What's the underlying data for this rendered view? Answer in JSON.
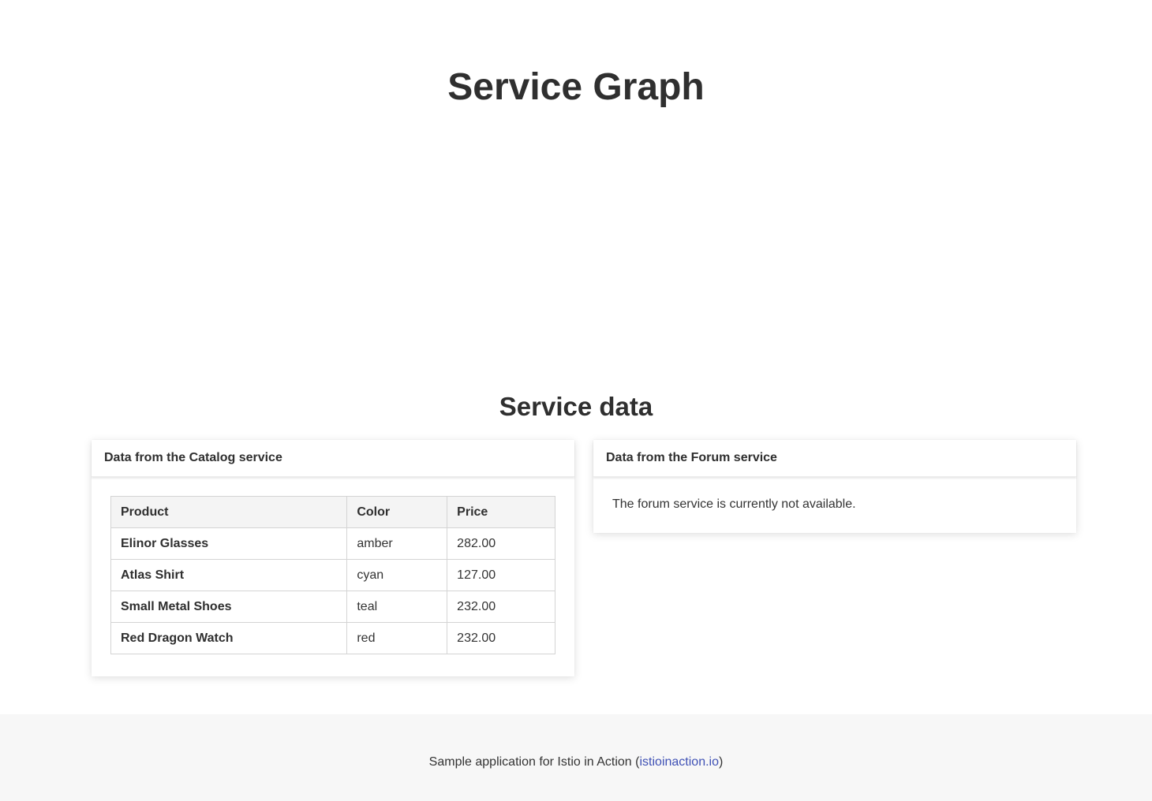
{
  "page": {
    "graph_title": "Service Graph",
    "data_title": "Service data"
  },
  "catalog": {
    "header": "Data from the Catalog service",
    "columns": [
      "Product",
      "Color",
      "Price"
    ],
    "rows": [
      {
        "product": "Elinor Glasses",
        "color": "amber",
        "price": "282.00"
      },
      {
        "product": "Atlas Shirt",
        "color": "cyan",
        "price": "127.00"
      },
      {
        "product": "Small Metal Shoes",
        "color": "teal",
        "price": "232.00"
      },
      {
        "product": "Red Dragon Watch",
        "color": "red",
        "price": "232.00"
      }
    ]
  },
  "forum": {
    "header": "Data from the Forum service",
    "message": "The forum service is currently not available."
  },
  "footer": {
    "prefix": "Sample application for Istio in Action (",
    "link_label": "istioinaction.io",
    "suffix": ")"
  },
  "colors": {
    "link": "#3f51b5",
    "footer_background": "#f7f7f7",
    "table_header_background": "#f4f4f4"
  }
}
